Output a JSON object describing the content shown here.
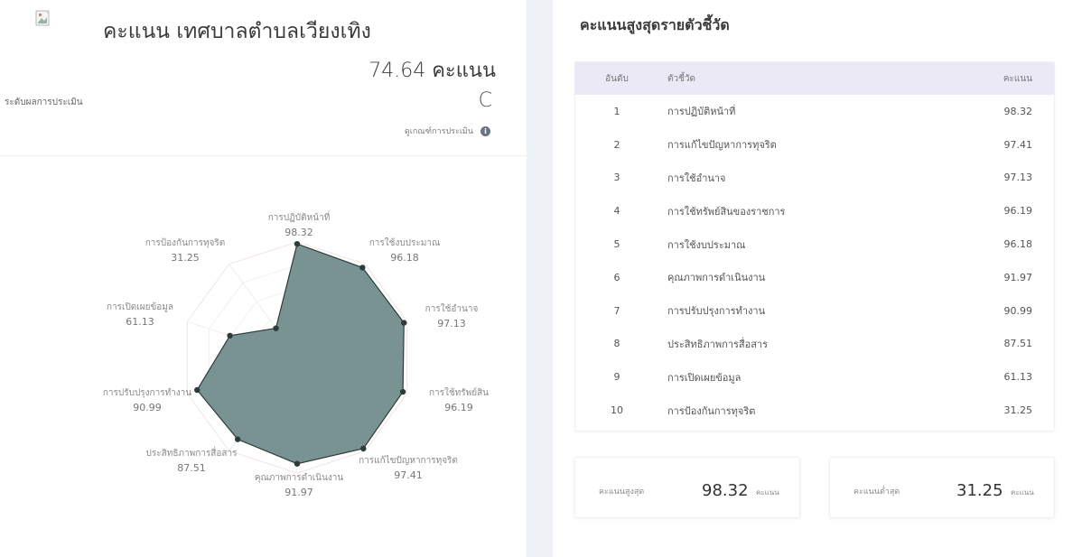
{
  "header": {
    "title": "คะแนน เทศบาลตำบลเวียงเทิง",
    "score_text": "74.64 คะแนน",
    "level_label": "ระดับผลการประเมิน",
    "grade": "C",
    "criteria_link": "ดูเกณฑ์การประเมิน",
    "logo_alt_icon": "broken-image-icon"
  },
  "radar": {
    "max": 100,
    "axes": [
      {
        "label": "การปฏิบัติหน้าที่",
        "value": 98.32,
        "value_text": "98.32"
      },
      {
        "label": "การใช้งบประมาณ",
        "value": 96.18,
        "value_text": "96.18"
      },
      {
        "label": "การใช้อำนาจ",
        "value": 97.13,
        "value_text": "97.13"
      },
      {
        "label": "การใช้ทรัพย์สิน",
        "value": 96.19,
        "value_text": "96.19"
      },
      {
        "label": "การแก้ไขปัญหาการทุจริต",
        "value": 97.41,
        "value_text": "97.41"
      },
      {
        "label": "คุณภาพการดำเนินงาน",
        "value": 91.97,
        "value_text": "91.97"
      },
      {
        "label": "ประสิทธิภาพการสื่อสาร",
        "value": 87.51,
        "value_text": "87.51"
      },
      {
        "label": "การปรับปรุงการทำงาน",
        "value": 90.99,
        "value_text": "90.99"
      },
      {
        "label": "การเปิดเผยข้อมูล",
        "value": 61.13,
        "value_text": "61.13"
      },
      {
        "label": "การป้องกันการทุจริต",
        "value": 31.25,
        "value_text": "31.25"
      }
    ],
    "fill_color": "#6d8a89",
    "stroke_color": "#2e3a3a"
  },
  "ranking": {
    "title": "คะแนนสูงสุดรายตัวชี้วัด",
    "columns": {
      "rank": "อันดับ",
      "name": "ตัวชี้วัด",
      "score": "คะแนน"
    },
    "rows": [
      {
        "rank": "1",
        "name": "การปฏิบัติหน้าที่",
        "score": "98.32"
      },
      {
        "rank": "2",
        "name": "การแก้ไขปัญหาการทุจริต",
        "score": "97.41"
      },
      {
        "rank": "3",
        "name": "การใช้อำนาจ",
        "score": "97.13"
      },
      {
        "rank": "4",
        "name": "การใช้ทรัพย์สินของราชการ",
        "score": "96.19"
      },
      {
        "rank": "5",
        "name": "การใช้งบประมาณ",
        "score": "96.18"
      },
      {
        "rank": "6",
        "name": "คุณภาพการดำเนินงาน",
        "score": "91.97"
      },
      {
        "rank": "7",
        "name": "การปรับปรุงการทำงาน",
        "score": "90.99"
      },
      {
        "rank": "8",
        "name": "ประสิทธิภาพการสื่อสาร",
        "score": "87.51"
      },
      {
        "rank": "9",
        "name": "การเปิดเผยข้อมูล",
        "score": "61.13"
      },
      {
        "rank": "10",
        "name": "การป้องกันการทุจริต",
        "score": "31.25"
      }
    ]
  },
  "stats": {
    "max_label": "คะแนนสูงสุด",
    "max_value": "98.32",
    "min_label": "คะแนนต่ำสุด",
    "min_value": "31.25",
    "unit": "คะแนน"
  }
}
